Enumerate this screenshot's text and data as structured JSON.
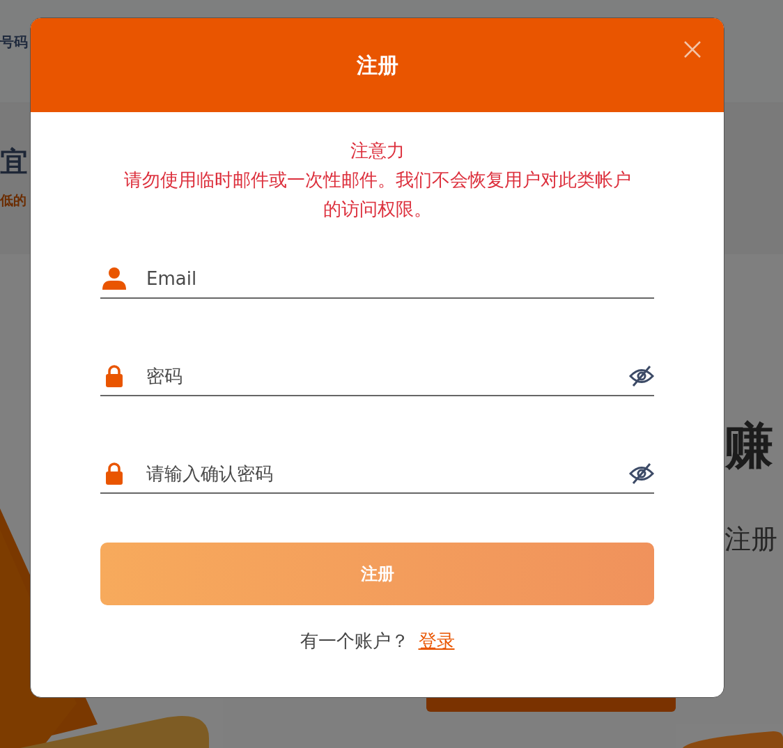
{
  "background": {
    "nav_text": "号码",
    "heading": "宜",
    "subheading": "低的",
    "right_heading": "赚",
    "right_text": "注册"
  },
  "modal": {
    "title": "注册",
    "notice": {
      "heading": "注意力",
      "text": "请勿使用临时邮件或一次性邮件。我们不会恢复用户对此类帐户的访问权限。"
    },
    "fields": [
      {
        "kind": "email",
        "placeholder": "Email"
      },
      {
        "kind": "password",
        "placeholder": "密码"
      },
      {
        "kind": "password",
        "placeholder": "请输入确认密码"
      }
    ],
    "submit": "注册",
    "footer": {
      "text": "有一个账户？",
      "link": "登录"
    }
  }
}
